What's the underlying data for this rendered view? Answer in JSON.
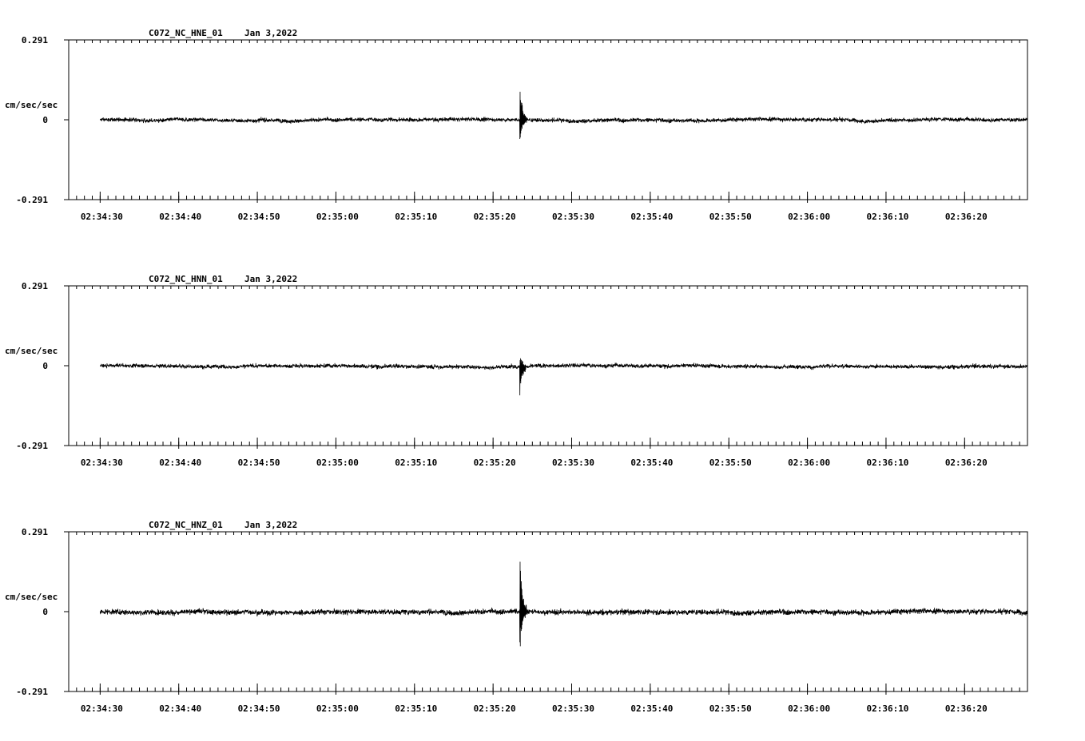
{
  "chart_data": [
    {
      "type": "line",
      "title": "C072_NC_HNE_01",
      "date": "Jan 3,2022",
      "ylabel": "cm/sec/sec",
      "ylim": [
        -0.291,
        0.291
      ],
      "ytick_labels": [
        "0.291",
        "0",
        "-0.291"
      ],
      "xtick_labels": [
        "02:34:30",
        "02:34:40",
        "02:34:50",
        "02:35:00",
        "02:35:10",
        "02:35:20",
        "02:35:30",
        "02:35:40",
        "02:35:50",
        "02:36:00",
        "02:36:10",
        "02:36:20"
      ],
      "x_range": [
        "02:34:26",
        "02:36:28"
      ],
      "data_start": "02:34:30",
      "data_end": "02:36:28",
      "noise_amplitude": 0.022,
      "event": {
        "time": "02:35:23.4",
        "peak_positive": 0.15,
        "peak_negative": -0.09
      },
      "grid": false
    },
    {
      "type": "line",
      "title": "C072_NC_HNN_01",
      "date": "Jan 3,2022",
      "ylabel": "cm/sec/sec",
      "ylim": [
        -0.291,
        0.291
      ],
      "ytick_labels": [
        "0.291",
        "0",
        "-0.291"
      ],
      "xtick_labels": [
        "02:34:30",
        "02:34:40",
        "02:34:50",
        "02:35:00",
        "02:35:10",
        "02:35:20",
        "02:35:30",
        "02:35:40",
        "02:35:50",
        "02:36:00",
        "02:36:10",
        "02:36:20"
      ],
      "x_range": [
        "02:34:26",
        "02:36:28"
      ],
      "data_start": "02:34:30",
      "data_end": "02:36:28",
      "noise_amplitude": 0.022,
      "event": {
        "time": "02:35:23.4",
        "peak_positive": 0.05,
        "peak_negative": -0.11
      },
      "grid": false
    },
    {
      "type": "line",
      "title": "C072_NC_HNZ_01",
      "date": "Jan 3,2022",
      "ylabel": "cm/sec/sec",
      "ylim": [
        -0.291,
        0.291
      ],
      "ytick_labels": [
        "0.291",
        "0",
        "-0.291"
      ],
      "xtick_labels": [
        "02:34:30",
        "02:34:40",
        "02:34:50",
        "02:35:00",
        "02:35:10",
        "02:35:20",
        "02:35:30",
        "02:35:40",
        "02:35:50",
        "02:36:00",
        "02:36:10",
        "02:36:20"
      ],
      "x_range": [
        "02:34:26",
        "02:36:28"
      ],
      "data_start": "02:34:30",
      "data_end": "02:36:28",
      "noise_amplitude": 0.03,
      "event": {
        "time": "02:35:23.4",
        "peak_positive": 0.22,
        "peak_negative": -0.16
      },
      "grid": false
    }
  ]
}
